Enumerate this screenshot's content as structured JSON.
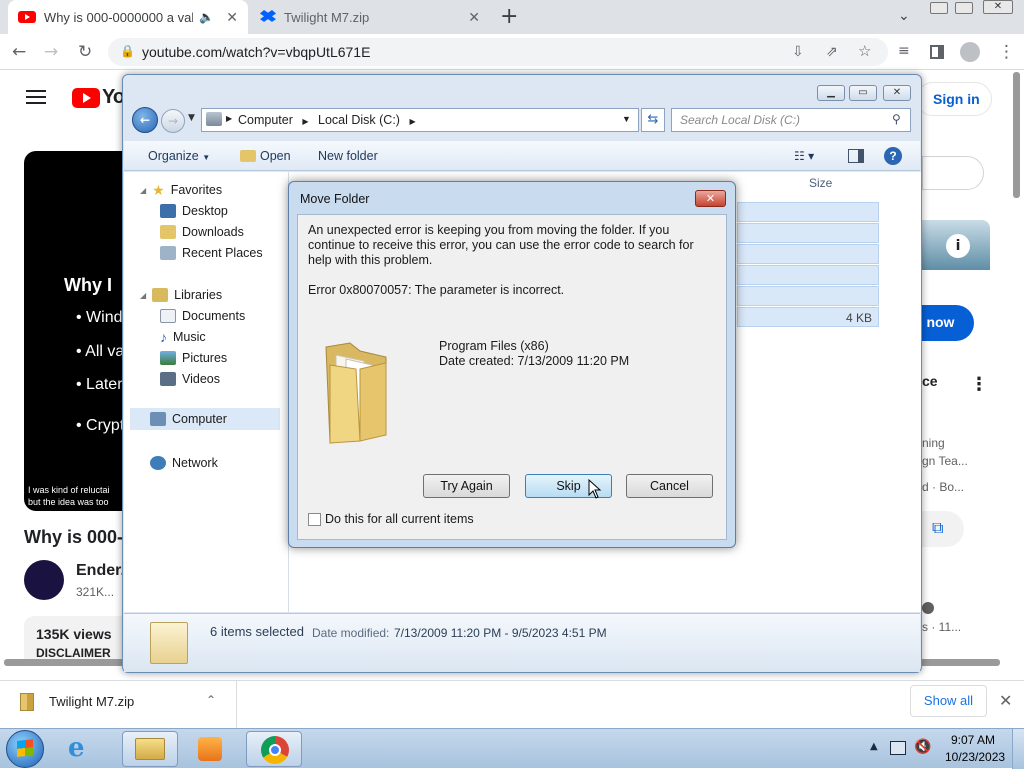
{
  "browser": {
    "tabs": [
      {
        "title": "Why is 000-0000000 a valid",
        "active": true
      },
      {
        "title": "Twilight M7.zip",
        "active": false
      }
    ],
    "new_tab": "+",
    "url": "youtube.com/watch?v=vbqpUtL671E"
  },
  "youtube": {
    "logo": "YouTube",
    "sign_in": "Sign in",
    "video_lines": [
      "Why I",
      "• Windo",
      "• All vali",
      "• Later V",
      "• Crypto"
    ],
    "video_caption": [
      "I was kind of reluctai",
      "but the idea was too"
    ],
    "video_title": "Why is 000-",
    "channel_name": "Ender.",
    "subscribers": "321K...",
    "views": "135K views",
    "disclaimer": "DISCLAIMER",
    "right_partial": {
      "now": "o now",
      "ce": "ce",
      "ning": "ning",
      "team": "gn Tea...",
      "bo": "d · Bo...",
      "eleven": "s · 11..."
    }
  },
  "explorer": {
    "breadcrumb": [
      "Computer",
      "Local Disk (C:)"
    ],
    "search_placeholder": "Search Local Disk (C:)",
    "toolbar": {
      "organize": "Organize",
      "open": "Open",
      "new_folder": "New folder"
    },
    "column_size": "Size",
    "file_size_last": "4 KB",
    "nav": {
      "favorites": "Favorites",
      "desktop": "Desktop",
      "downloads": "Downloads",
      "recent": "Recent Places",
      "libraries": "Libraries",
      "documents": "Documents",
      "music": "Music",
      "pictures": "Pictures",
      "videos": "Videos",
      "computer": "Computer",
      "network": "Network"
    },
    "details": {
      "selected": "6 items selected",
      "date_label": "Date modified:",
      "date_range": "7/13/2009 11:20 PM - 9/5/2023 4:51 PM"
    }
  },
  "dialog": {
    "title": "Move Folder",
    "message": "An unexpected error is keeping you from moving the folder. If you continue to receive this error, you can use the error code to search for help with this problem.",
    "error": "Error 0x80070057: The parameter is incorrect.",
    "item_name": "Program Files (x86)",
    "item_date": "Date created: 7/13/2009 11:20 PM",
    "buttons": {
      "try_again": "Try Again",
      "skip": "Skip",
      "cancel": "Cancel"
    },
    "checkbox_label": "Do this for all current items"
  },
  "download_bar": {
    "file": "Twilight M7.zip",
    "show_all": "Show all"
  },
  "taskbar": {
    "time": "9:07 AM",
    "date": "10/23/2023"
  },
  "colors": {
    "yt_red": "#ff0000",
    "link_blue": "#065fd4",
    "win_blue": "#dce7f3"
  }
}
